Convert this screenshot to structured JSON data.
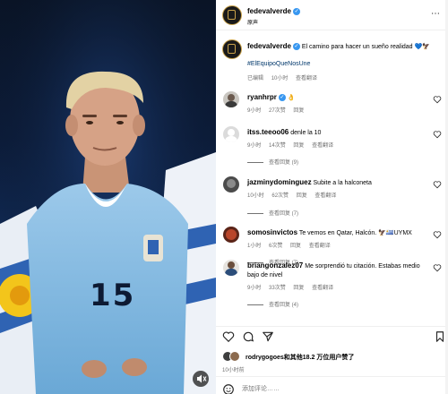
{
  "post": {
    "username": "fedevalverde",
    "header_sub": "原声",
    "caption_text": "El camino para hacer un sueño realidad 💙🦅",
    "hashtag": "#ElEquipoQueNosUne",
    "caption_edited": "已编辑",
    "caption_time": "10小时",
    "caption_translate": "查看翻译",
    "jersey_number": "15"
  },
  "comments": [
    {
      "user": "ryanhrpr",
      "verified": true,
      "text": "👌",
      "time": "9小时",
      "likes": "27次赞",
      "reply": "回复",
      "translate": "",
      "replies": ""
    },
    {
      "user": "itss.teeoo06",
      "verified": false,
      "text": "denle la 10",
      "time": "9小时",
      "likes": "14次赞",
      "reply": "回复",
      "translate": "查看翻译",
      "replies": "查看回复 (9)"
    },
    {
      "user": "jazminydominguez",
      "verified": false,
      "text": "Subite a la halconeta",
      "time": "10小时",
      "likes": "62次赞",
      "reply": "回复",
      "translate": "查看翻译",
      "replies": "查看回复 (7)"
    },
    {
      "user": "somosinvictos",
      "verified": false,
      "text": "Te vemos en Qatar, Halcón. 🦅🇺🇾UYMX",
      "time": "1小时",
      "likes": "6次赞",
      "reply": "回复",
      "translate": "查看翻译",
      "replies": "查看回复 (7)"
    },
    {
      "user": "briangonzalez07",
      "verified": false,
      "text": "Me sorprendió tu citación. Estabas medio bajo de nivel",
      "time": "9小时",
      "likes": "33次赞",
      "reply": "回复",
      "translate": "查看翻译",
      "replies": "查看回复 (4)"
    }
  ],
  "footer": {
    "liked_by": "rodrygogoes和其他18.2 万位用户赞了",
    "time": "10小时前",
    "comment_placeholder": "添加评论……"
  },
  "icons": {
    "like": "heart-icon",
    "comment": "comment-icon",
    "share": "share-icon",
    "save": "bookmark-icon",
    "sound": "speaker-icon",
    "emoji": "emoji-icon"
  },
  "colors": {
    "verified": "#3897f0",
    "link": "#00376b",
    "muted": "#737373"
  }
}
